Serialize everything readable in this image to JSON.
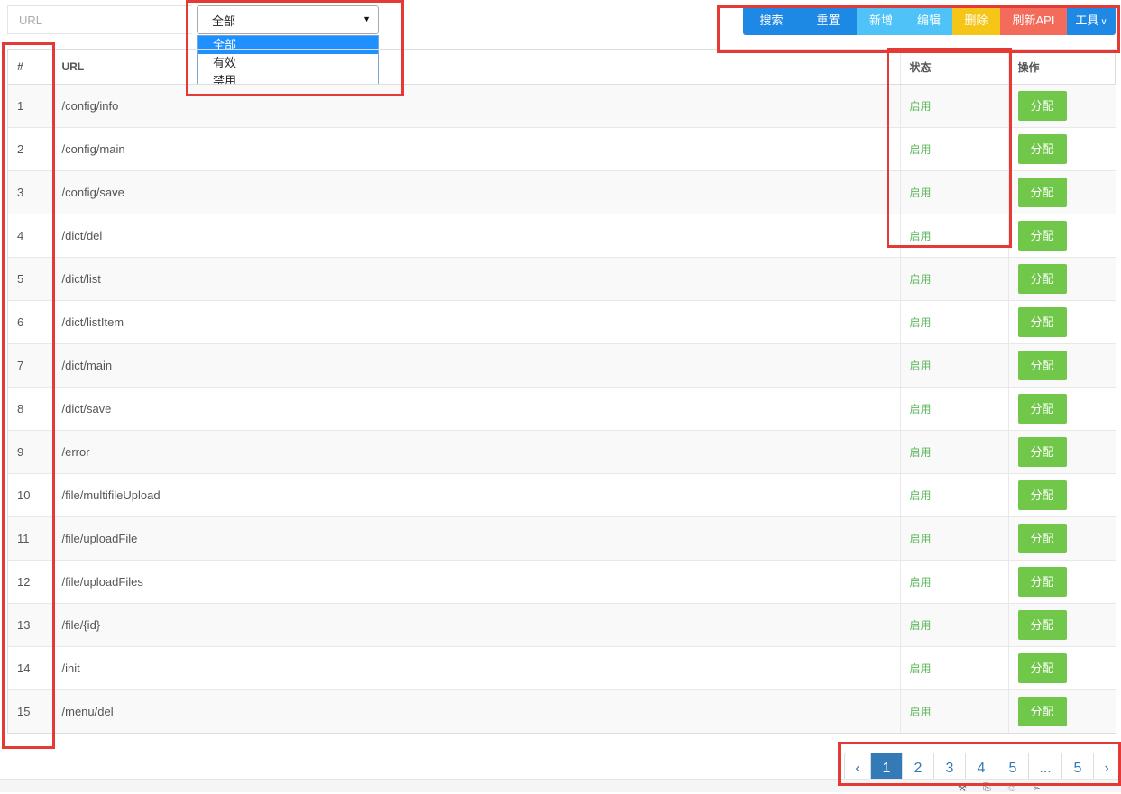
{
  "filters": {
    "url_placeholder": "URL",
    "status_selected": "全部",
    "status_options": [
      "全部",
      "有效",
      "禁用"
    ]
  },
  "toolbar": {
    "search": "搜索",
    "reset": "重置",
    "add": "新增",
    "edit": "编辑",
    "delete": "删除",
    "refresh_api": "刷新API",
    "tools": "工具"
  },
  "table": {
    "headers": [
      "#",
      "URL",
      "状态",
      "操作"
    ],
    "rows": [
      {
        "num": "1",
        "url": "/config/info",
        "status": "启用",
        "action": "分配"
      },
      {
        "num": "2",
        "url": "/config/main",
        "status": "启用",
        "action": "分配"
      },
      {
        "num": "3",
        "url": "/config/save",
        "status": "启用",
        "action": "分配"
      },
      {
        "num": "4",
        "url": "/dict/del",
        "status": "启用",
        "action": "分配"
      },
      {
        "num": "5",
        "url": "/dict/list",
        "status": "启用",
        "action": "分配"
      },
      {
        "num": "6",
        "url": "/dict/listItem",
        "status": "启用",
        "action": "分配"
      },
      {
        "num": "7",
        "url": "/dict/main",
        "status": "启用",
        "action": "分配"
      },
      {
        "num": "8",
        "url": "/dict/save",
        "status": "启用",
        "action": "分配"
      },
      {
        "num": "9",
        "url": "/error",
        "status": "启用",
        "action": "分配"
      },
      {
        "num": "10",
        "url": "/file/multifileUpload",
        "status": "启用",
        "action": "分配"
      },
      {
        "num": "11",
        "url": "/file/uploadFile",
        "status": "启用",
        "action": "分配"
      },
      {
        "num": "12",
        "url": "/file/uploadFiles",
        "status": "启用",
        "action": "分配"
      },
      {
        "num": "13",
        "url": "/file/{id}",
        "status": "启用",
        "action": "分配"
      },
      {
        "num": "14",
        "url": "/init",
        "status": "启用",
        "action": "分配"
      },
      {
        "num": "15",
        "url": "/menu/del",
        "status": "启用",
        "action": "分配"
      }
    ]
  },
  "pagination": {
    "prev": "‹",
    "pages": [
      "1",
      "2",
      "3",
      "4",
      "5",
      "...",
      "5"
    ],
    "active": "1",
    "next": "›"
  },
  "colors": {
    "primary": "#1e88e5",
    "info": "#4fc3f7",
    "warning": "#f5c518",
    "danger": "#f26b5b",
    "success": "#71c74a",
    "annotation": "#e53935"
  }
}
